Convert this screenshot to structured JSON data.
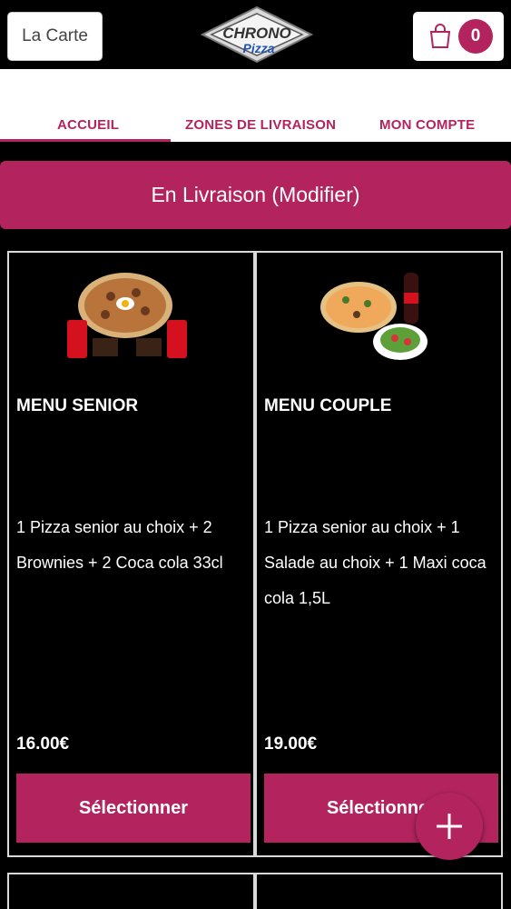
{
  "header": {
    "carte_label": "La Carte",
    "logo_line1": "CHRONO",
    "logo_line2": "Pizza",
    "cart_count": "0",
    "cart_icon": "shopping-bag-icon"
  },
  "nav": {
    "tabs": [
      {
        "label": "ACCUEIL",
        "active": true
      },
      {
        "label": "ZONES DE LIVRAISON",
        "active": false
      },
      {
        "label": "MON COMPTE",
        "active": false
      }
    ]
  },
  "delivery": {
    "label": "En Livraison (Modifier)"
  },
  "products": [
    {
      "name": "MENU SENIOR",
      "description": "1 Pizza senior au choix  + 2 Brownies  + 2 Coca cola 33cl",
      "price": "16.00€",
      "button": "Sélectionner"
    },
    {
      "name": "MENU COUPLE",
      "description": "1 Pizza senior au choix  + 1 Salade au choix  + 1 Maxi coca cola 1,5L",
      "price": "19.00€",
      "button": "Sélectionner"
    }
  ],
  "fab_icon": "plus-icon",
  "colors": {
    "accent": "#b3245f",
    "background": "#000000"
  }
}
